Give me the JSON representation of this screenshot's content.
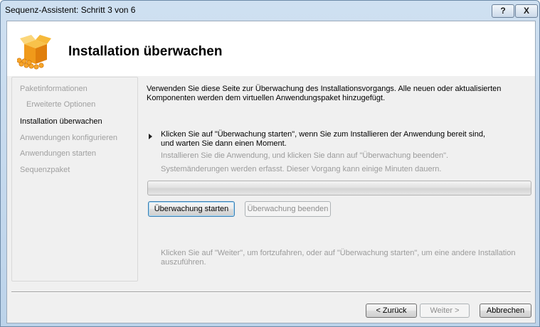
{
  "window": {
    "title": "Sequenz-Assistent: Schritt 3 von 6",
    "help_label": "?",
    "close_label": "X"
  },
  "header": {
    "title": "Installation überwachen",
    "icon": "package-box-icon"
  },
  "nav": {
    "items": [
      {
        "label": "Paketinformationen",
        "state": "inactive"
      },
      {
        "label": "Erweiterte Optionen",
        "state": "inactive"
      },
      {
        "label": "Installation überwachen",
        "state": "active"
      },
      {
        "label": "Anwendungen konfigurieren",
        "state": "inactive"
      },
      {
        "label": "Anwendungen starten",
        "state": "inactive"
      },
      {
        "label": "Sequenzpaket",
        "state": "inactive"
      }
    ]
  },
  "main": {
    "description": "Verwenden Sie diese Seite zur Überwachung des Installationsvorgangs. Alle neuen oder aktualisierten Komponenten werden dem virtuellen Anwendungspaket hinzugefügt.",
    "step_instruction": "Klicken Sie auf \"Überwachung starten\", wenn Sie zum Installieren der Anwendung bereit sind, und warten Sie dann einen Moment.",
    "step_install": "Installieren Sie die Anwendung, und klicken Sie dann auf \"Überwachung beenden\".",
    "step_capture": "Systemänderungen werden erfasst. Dieser Vorgang kann einige Minuten dauern.",
    "progress": 0,
    "start_button": "Überwachung starten",
    "stop_button": "Überwachung beenden",
    "note": "Klicken Sie auf \"Weiter\", um fortzufahren, oder auf \"Überwachung starten\", um eine andere Installation auszuführen."
  },
  "footer": {
    "back_button": "< Zurück",
    "next_button": "Weiter >",
    "cancel_button": "Abbrechen"
  },
  "colors": {
    "accent": "#3c7fb1",
    "inactive_text": "#a0a0a0",
    "disabled_text": "#9b9b9b"
  }
}
